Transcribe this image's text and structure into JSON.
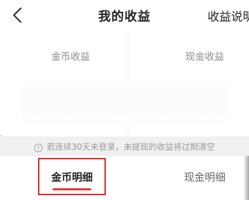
{
  "header": {
    "title": "我的收益",
    "explain_label": "收益说明"
  },
  "summary": {
    "coin_label": "金币收益",
    "cash_label": "现金收益"
  },
  "notice": {
    "text": "若连续30天未登录，未提现的收益将过期清空",
    "icon": "info-icon"
  },
  "tabs": [
    {
      "label": "金币明细",
      "active": true
    },
    {
      "label": "现金明细",
      "active": false
    }
  ],
  "colors": {
    "accent": "#e53935",
    "highlight": "#e0262d",
    "muted_text": "#8a8a8a",
    "notice_bg": "#f0f0f0"
  }
}
